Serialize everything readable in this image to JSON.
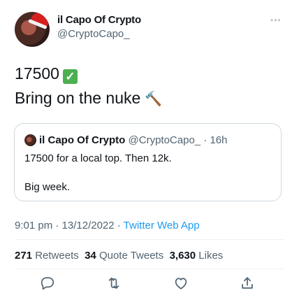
{
  "author": {
    "name": "il Capo Of Crypto",
    "handle": "@CryptoCapo_"
  },
  "tweet": {
    "line1": "17500",
    "line1_emoji": "✓",
    "line2": "Bring on the nuke",
    "line2_emoji": "🔨"
  },
  "quoted": {
    "name": "il Capo Of Crypto",
    "meta": "@CryptoCapo_ · 16h",
    "text1": "17500 for a local top. Then 12k.",
    "text2": "Big week."
  },
  "meta": {
    "time_date": "9:01 pm · 13/12/2022 · ",
    "source": "Twitter Web App"
  },
  "stats": {
    "retweets_count": "271",
    "retweets_label": "Retweets",
    "quotes_count": "34",
    "quotes_label": "Quote Tweets",
    "likes_count": "3,630",
    "likes_label": "Likes"
  },
  "icons": {
    "more": "more-horizontal-icon",
    "reply": "reply-icon",
    "retweet": "retweet-icon",
    "like": "like-icon",
    "share": "share-icon"
  },
  "colors": {
    "accent": "#1d9bf0",
    "muted": "#536471",
    "check": "#4caf50"
  }
}
